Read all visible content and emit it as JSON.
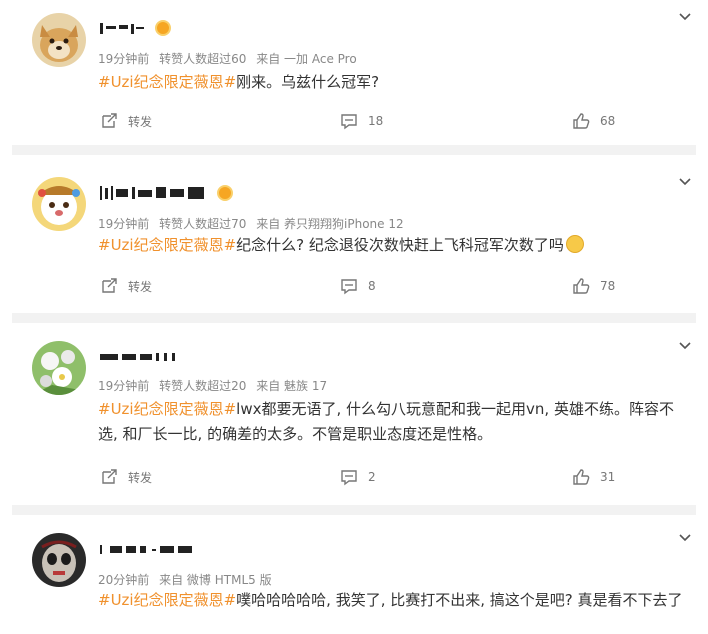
{
  "posts": [
    {
      "username": "",
      "time": "19分钟前",
      "likes_note": "转赞人数超过60",
      "source": "来自 一加 Ace Pro",
      "tag": "#Uzi纪念限定薇恩#",
      "text": "刚来。乌兹什么冠军?",
      "repost_label": "转发",
      "comments": "18",
      "likes": "68"
    },
    {
      "username": "",
      "time": "19分钟前",
      "likes_note": "转赞人数超过70",
      "source": "来自 养只翔翔狗iPhone 12",
      "tag": "#Uzi纪念限定薇恩#",
      "text": "纪念什么? 纪念退役次数快赶上飞科冠军次数了吗",
      "repost_label": "转发",
      "comments": "8",
      "likes": "78"
    },
    {
      "username": "",
      "time": "19分钟前",
      "likes_note": "转赞人数超过20",
      "source": "来自 魅族 17",
      "tag": "#Uzi纪念限定薇恩#",
      "text": "lwx都要无语了, 什么勾八玩意配和我一起用vn, 英雄不练。阵容不选, 和厂长一比, 的确差的太多。不管是职业态度还是性格。",
      "repost_label": "转发",
      "comments": "2",
      "likes": "31"
    },
    {
      "username": "",
      "time": "20分钟前",
      "likes_note": "",
      "source": "来自 微博 HTML5 版",
      "tag": "#Uzi纪念限定薇恩#",
      "text": "噗哈哈哈哈哈, 我笑了, 比赛打不出来, 搞这个是吧? 真是看不下去了",
      "repost_label": "",
      "comments": "",
      "likes": ""
    }
  ],
  "icons": {
    "more": "chevron-down-icon",
    "repost": "repost-icon",
    "comment": "comment-icon",
    "like": "thumbs-up-icon"
  },
  "colors": {
    "tag": "#f0912d",
    "meta": "#888888",
    "divider": "#f2f2f2"
  }
}
